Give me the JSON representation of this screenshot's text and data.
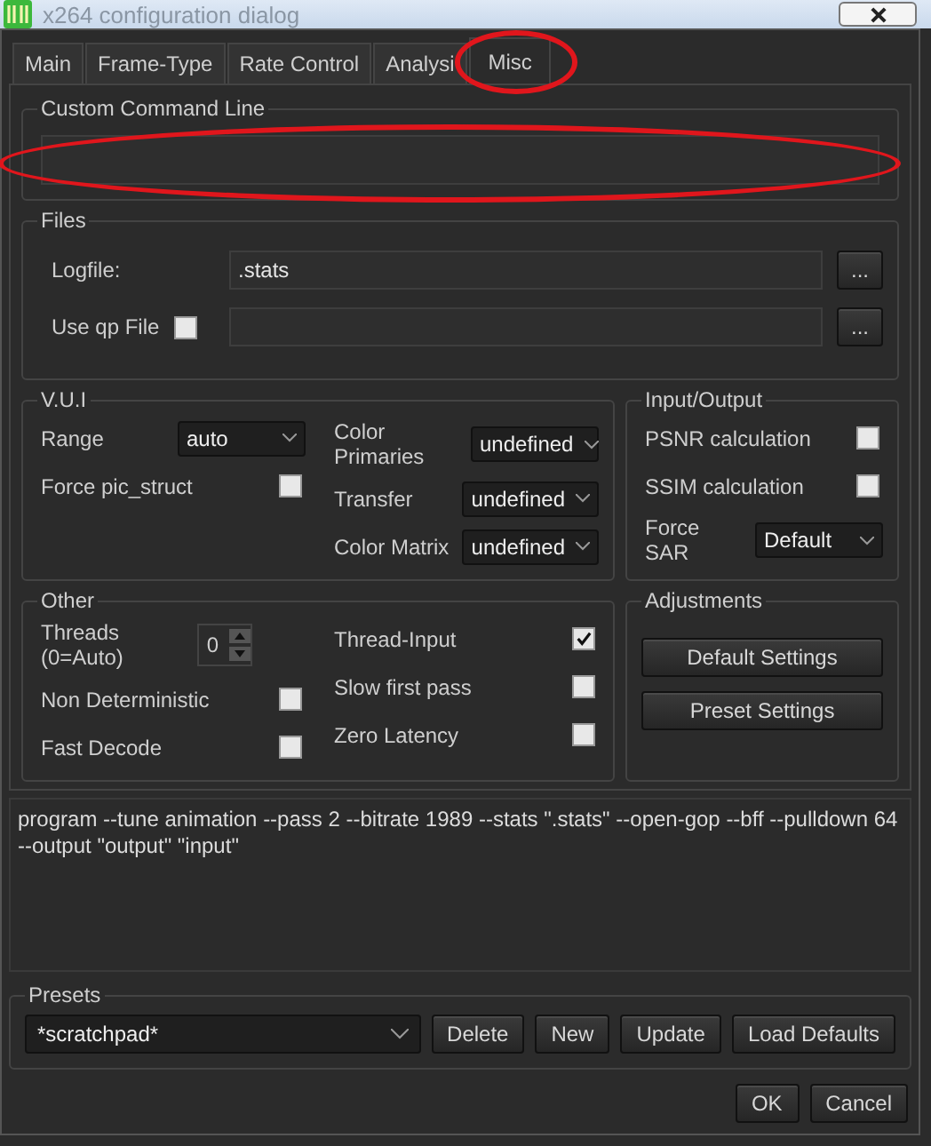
{
  "window": {
    "title": "x264 configuration dialog"
  },
  "tabs": [
    {
      "label": "Main",
      "selected": false,
      "circled": false
    },
    {
      "label": "Frame-Type",
      "selected": false,
      "circled": false
    },
    {
      "label": "Rate Control",
      "selected": false,
      "circled": false
    },
    {
      "label": "Analysi",
      "selected": false,
      "circled": false
    },
    {
      "label": "Misc",
      "selected": true,
      "circled": true
    }
  ],
  "custom_command_line": {
    "title": "Custom Command Line",
    "circled": true
  },
  "files": {
    "title": "Files",
    "rows": [
      {
        "label": "Logfile:",
        "kind": "file",
        "value": ".stats",
        "browse": "..."
      },
      {
        "label": "Use qp File",
        "kind": "checkfile",
        "checked": false,
        "browse": "..."
      }
    ]
  },
  "vui": {
    "title": "V.U.I",
    "columns": [
      [
        {
          "kind": "select",
          "label": "Range",
          "value": "auto"
        },
        {
          "kind": "checkbox",
          "label": "Force pic_struct",
          "checked": false
        }
      ],
      [
        {
          "kind": "select",
          "label": "Color Primaries",
          "value": "undefined"
        },
        {
          "kind": "select",
          "label": "Transfer",
          "value": "undefined"
        },
        {
          "kind": "select",
          "label": "Color Matrix",
          "value": "undefined"
        }
      ]
    ]
  },
  "input_output": {
    "title": "Input/Output",
    "columns": [
      [
        {
          "kind": "checkbox",
          "label": "PSNR calculation",
          "checked": false
        },
        {
          "kind": "checkbox",
          "label": "SSIM calculation",
          "checked": false
        },
        {
          "kind": "select",
          "label": "Force SAR",
          "value": "Default"
        }
      ]
    ]
  },
  "other": {
    "title": "Other",
    "columns": [
      [
        {
          "kind": "spin",
          "label": "Threads (0=Auto)",
          "value": "0"
        },
        {
          "kind": "checkbox",
          "label": "Non Deterministic",
          "checked": false
        },
        {
          "kind": "checkbox",
          "label": "Fast Decode",
          "checked": false
        }
      ],
      [
        {
          "kind": "checkbox",
          "label": "Thread-Input",
          "checked": true
        },
        {
          "kind": "checkbox",
          "label": "Slow first pass",
          "checked": false
        },
        {
          "kind": "checkbox",
          "label": "Zero Latency",
          "checked": false
        }
      ]
    ]
  },
  "adjustments": {
    "title": "Adjustments",
    "buttons": [
      "Default Settings",
      "Preset Settings"
    ]
  },
  "command_preview": "program --tune animation --pass 2 --bitrate 1989 --stats \".stats\" --open-gop --bff --pulldown 64 --output \"output\" \"input\"",
  "presets": {
    "title": "Presets",
    "value": "*scratchpad*",
    "buttons": [
      "Delete",
      "New",
      "Update",
      "Load Defaults"
    ]
  },
  "dialog_buttons": [
    "OK",
    "Cancel"
  ]
}
